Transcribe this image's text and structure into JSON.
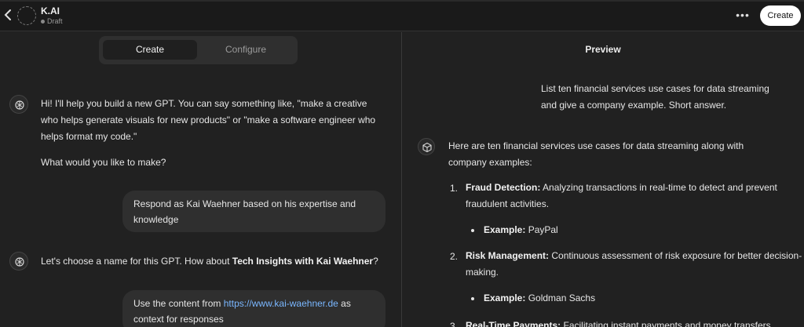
{
  "header": {
    "name": "K.AI",
    "status": "Draft",
    "more_label": "•••",
    "create_label": "Create"
  },
  "tabs": [
    {
      "label": "Create",
      "active": true
    },
    {
      "label": "Configure",
      "active": false
    }
  ],
  "left_chat": {
    "bot_intro": "Hi! I'll help you build a new GPT. You can say something like, \"make a creative who helps generate visuals for new products\" or \"make a software engineer who helps format my code.\"",
    "bot_question": "What would you like to make?",
    "user_msg_1": "Respond as Kai Waehner based on his expertise and knowledge",
    "bot_name_prefix": "Let's choose a name for this GPT. How about ",
    "bot_name_bold": "Tech Insights with Kai Waehner",
    "bot_name_suffix": "?",
    "user_msg_2_prefix": "Use the content from ",
    "user_msg_2_link": "https://www.kai-waehner.de",
    "user_msg_2_suffix": " as context for responses"
  },
  "preview": {
    "title": "Preview",
    "user_prompt": "List ten financial services use cases for data streaming and give a company example. Short answer.",
    "answer_intro": "Here are ten financial services use cases for data streaming along with company examples:",
    "items": [
      {
        "num": "1.",
        "title": "Fraud Detection:",
        "desc": " Analyzing transactions in real-time to detect and prevent fraudulent activities.",
        "example_label": "Example:",
        "example": " PayPal"
      },
      {
        "num": "2.",
        "title": "Risk Management:",
        "desc": " Continuous assessment of risk exposure for better decision-making.",
        "example_label": "Example:",
        "example": " Goldman Sachs"
      },
      {
        "num": "3.",
        "title": "Real-Time Payments:",
        "desc": " Facilitating instant payments and money transfers."
      }
    ]
  },
  "colors": {
    "background": "#212121",
    "bubble": "#2f2f2f",
    "link": "#7ab7ff"
  }
}
